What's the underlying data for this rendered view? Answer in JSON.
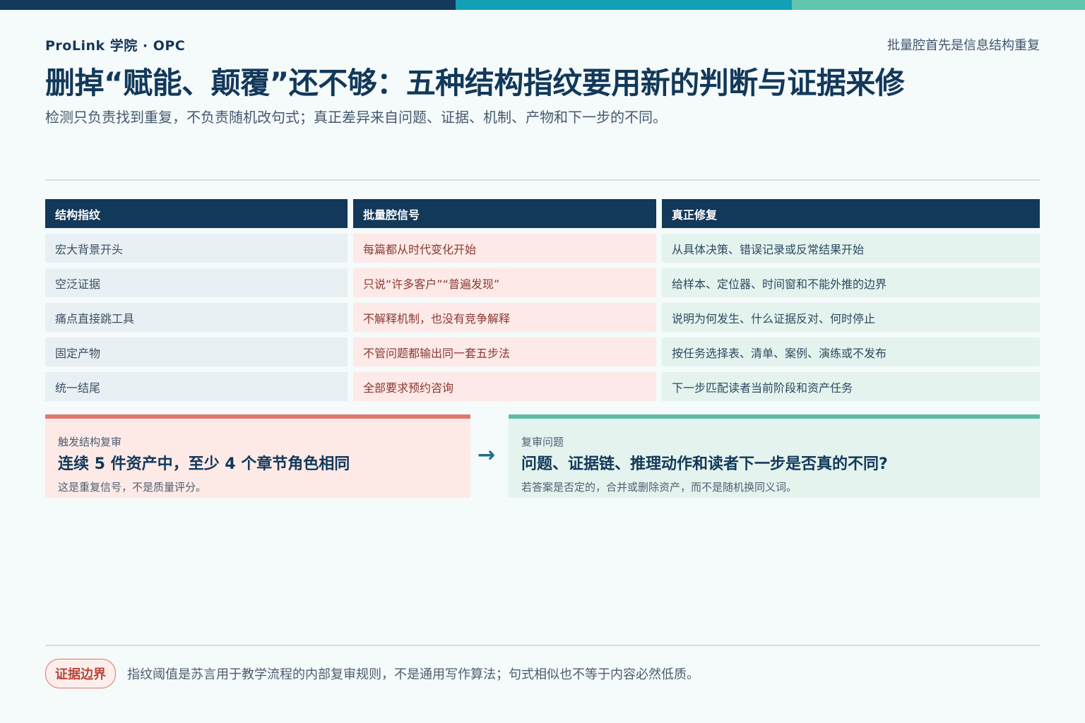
{
  "header": {
    "brand": "ProLink 学院 · OPC",
    "corner_tag": "批量腔首先是信息结构重复",
    "title": "删掉“赋能、颠覆”还不够：五种结构指纹要用新的判断与证据来修",
    "subtitle": "检测只负责找到重复，不负责随机改句式；真正差异来自问题、证据、机制、产物和下一步的不同。"
  },
  "colors": {
    "navy": "#12385a",
    "teal": "#139fb6",
    "mint": "#62c5b0",
    "coral": "#e0786e"
  },
  "table": {
    "headers": [
      "结构指纹",
      "批量腔信号",
      "真正修复"
    ],
    "rows": [
      [
        "宏大背景开头",
        "每篇都从时代变化开始",
        "从具体决策、错误记录或反常结果开始"
      ],
      [
        "空泛证据",
        "只说“许多客户”“普遍发现”",
        "给样本、定位器、时间窗和不能外推的边界"
      ],
      [
        "痛点直接跳工具",
        "不解释机制，也没有竞争解释",
        "说明为何发生、什么证据反对、何时停止"
      ],
      [
        "固定产物",
        "不管问题都输出同一套五步法",
        "按任务选择表、清单、案例、演练或不发布"
      ],
      [
        "统一结尾",
        "全部要求预约咨询",
        "下一步匹配读者当前阶段和资产任务"
      ]
    ]
  },
  "trigger_card": {
    "label": "触发结构复审",
    "headline": "连续 5 件资产中，至少 4 个章节角色相同",
    "note": "这是重复信号，不是质量评分。"
  },
  "arrow_icon": "→",
  "review_card": {
    "label": "复审问题",
    "headline": "问题、证据链、推理动作和读者下一步是否真的不同?",
    "note": "若答案是否定的，合并或删除资产，而不是随机换同义词。"
  },
  "footer": {
    "badge": "证据边界",
    "text": "指纹阈值是苏言用于教学流程的内部复审规则，不是通用写作算法；句式相似也不等于内容必然低质。"
  }
}
